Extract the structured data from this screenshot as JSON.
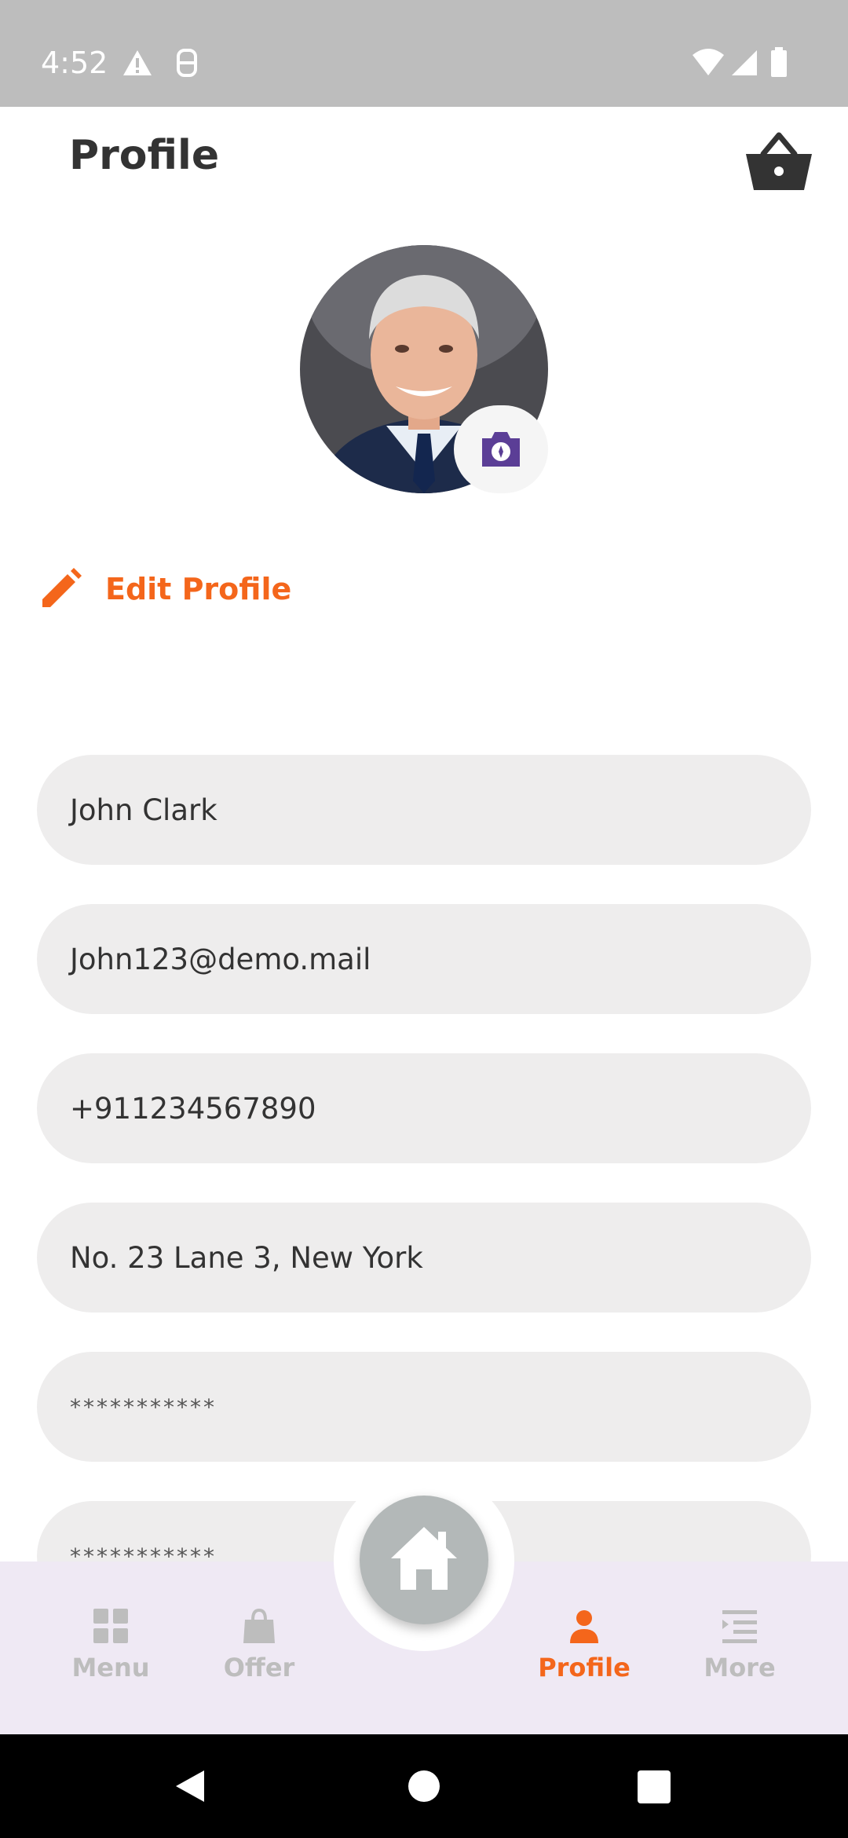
{
  "status_bar": {
    "time": "4:52"
  },
  "header": {
    "title": "Profile",
    "cart_icon": "basket-icon"
  },
  "profile": {
    "avatar_icon": "profile-photo",
    "camera_icon": "camera-icon"
  },
  "edit_profile": {
    "label": "Edit Profile",
    "icon": "pencil-icon"
  },
  "fields": [
    {
      "name": "name-field",
      "value": "John Clark"
    },
    {
      "name": "email-field",
      "value": "John123@demo.mail"
    },
    {
      "name": "phone-field",
      "value": "+911234567890"
    },
    {
      "name": "address-field",
      "value": "No. 23 Lane 3, New York"
    },
    {
      "name": "password-field",
      "value": "***********"
    },
    {
      "name": "confirm-password-field",
      "value": "***********"
    }
  ],
  "bottom_nav": {
    "items": [
      {
        "label": "Menu",
        "icon": "grid-icon",
        "active": false
      },
      {
        "label": "Offer",
        "icon": "bag-icon",
        "active": false
      },
      {
        "label": "Profile",
        "icon": "person-icon",
        "active": true
      },
      {
        "label": "More",
        "icon": "list-icon",
        "active": false
      }
    ],
    "center": {
      "icon": "home-icon"
    }
  },
  "colors": {
    "accent": "#f4661b",
    "field_bg": "#eeeded",
    "nav_bg": "#efe9f4",
    "camera": "#5b3e96"
  }
}
